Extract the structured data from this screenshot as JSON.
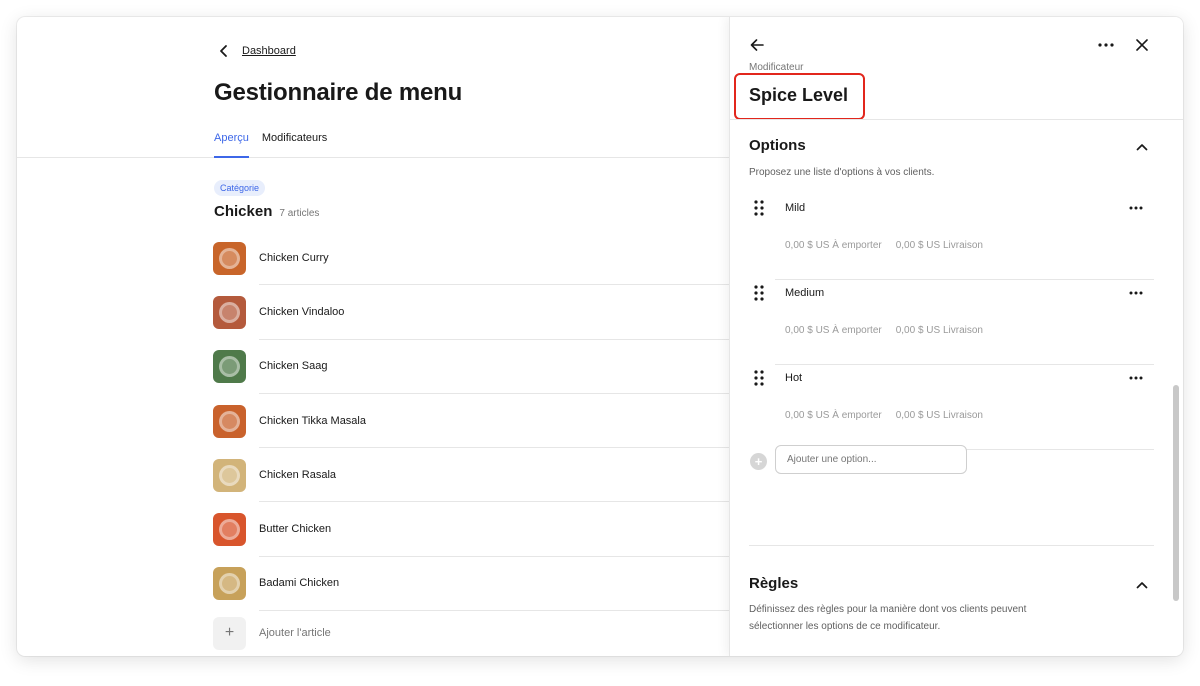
{
  "breadcrumb": {
    "back_label": "Dashboard"
  },
  "page": {
    "title": "Gestionnaire de menu"
  },
  "tabs": [
    {
      "label": "Aperçu",
      "active": true
    },
    {
      "label": "Modificateurs",
      "active": false
    }
  ],
  "category": {
    "badge": "Catégorie",
    "name": "Chicken",
    "count": "7 articles",
    "items": [
      {
        "name": "Chicken Curry",
        "thumb_color": "#c8652a"
      },
      {
        "name": "Chicken Vindaloo",
        "thumb_color": "#b45a3c"
      },
      {
        "name": "Chicken Saag",
        "thumb_color": "#4f7a4a"
      },
      {
        "name": "Chicken Tikka Masala",
        "thumb_color": "#c9622c"
      },
      {
        "name": "Chicken Rasala",
        "thumb_color": "#d2b47a"
      },
      {
        "name": "Butter Chicken",
        "thumb_color": "#d8552c"
      },
      {
        "name": "Badami Chicken",
        "thumb_color": "#c7a15a"
      }
    ],
    "add_label": "Ajouter l'article"
  },
  "panel": {
    "eyebrow": "Modificateur",
    "title": "Spice Level",
    "highlight_color": "#e2261c",
    "options_section": {
      "title": "Options",
      "description": "Proposez une liste d'options à vos clients.",
      "options": [
        {
          "name": "Mild",
          "takeout": "0,00 $ US À emporter",
          "delivery": "0,00 $ US Livraison"
        },
        {
          "name": "Medium",
          "takeout": "0,00 $ US À emporter",
          "delivery": "0,00 $ US Livraison"
        },
        {
          "name": "Hot",
          "takeout": "0,00 $ US À emporter",
          "delivery": "0,00 $ US Livraison"
        }
      ],
      "add_placeholder": "Ajouter une option..."
    },
    "rules_section": {
      "title": "Règles",
      "description": "Définissez des règles pour la manière dont vos clients peuvent sélectionner les options de ce modificateur."
    }
  },
  "accent_color": "#3d67e8"
}
